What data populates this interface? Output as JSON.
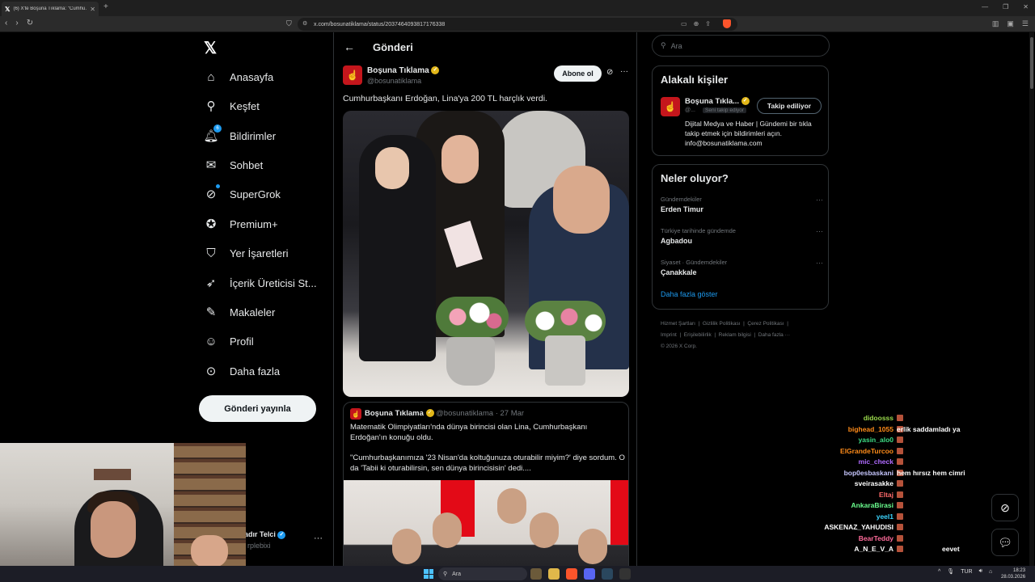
{
  "browser": {
    "tab_title": "(6) X'te Boşuna Tıklama: \"Cumhu...",
    "url": "x.com/bosunatiklama/status/2037464093817176338"
  },
  "nav": {
    "items": [
      {
        "label": "Anasayfa",
        "icon": "home-icon"
      },
      {
        "label": "Keşfet",
        "icon": "search-icon"
      },
      {
        "label": "Bildirimler",
        "icon": "bell-icon",
        "badge": "6"
      },
      {
        "label": "Sohbet",
        "icon": "mail-icon"
      },
      {
        "label": "SuperGrok",
        "icon": "grok-icon"
      },
      {
        "label": "Premium+",
        "icon": "premium-icon"
      },
      {
        "label": "Yer İşaretleri",
        "icon": "bookmark-icon"
      },
      {
        "label": "İçerik Üreticisi St...",
        "icon": "rocket-icon"
      },
      {
        "label": "Makaleler",
        "icon": "article-icon"
      },
      {
        "label": "Profil",
        "icon": "person-icon"
      },
      {
        "label": "Daha fazla",
        "icon": "more-circle-icon"
      }
    ],
    "post_button": "Gönderi yayınla",
    "account_name": "adır Telci",
    "account_handle": "rplebixi"
  },
  "post": {
    "header": "Gönderi",
    "author": "Boşuna Tıklama",
    "handle": "@bosunatiklama",
    "follow_label": "Abone ol",
    "text": "Cumhurbaşkanı Erdoğan, Lina'ya 200 TL harçlık verdi.",
    "quote": {
      "author": "Boşuna Tıklama",
      "handle": "@bosunatiklama",
      "date": "· 27 Mar",
      "text1": "Matematik Olimpiyatları'nda dünya birincisi olan Lina, Cumhurbaşkanı Erdoğan'ın konuğu oldu.",
      "text2": "\"Cumhurbaşkanımıza '23 Nisan'da koltuğunuza oturabilir miyim?' diye sordum. O da 'Tabii ki oturabilirsin, sen dünya birincisisin' dedi...."
    }
  },
  "sidebar": {
    "search_placeholder": "Ara",
    "related_title": "Alakalı kişiler",
    "related": {
      "name": "Boşuna Tıkla...",
      "handle": "@...",
      "tag": "Seni takip ediyor",
      "button": "Takip ediliyor",
      "bio": "Dijital Medya ve Haber | Gündemi bir tıkla takip etmek için bildirimleri açın. info@bosunatiklama.com"
    },
    "trends_title": "Neler oluyor?",
    "trends": [
      {
        "category": "Gündemdekiler",
        "topic": "Erden Timur"
      },
      {
        "category": "Türkiye tarihinde gündemde",
        "topic": "Agbadou"
      },
      {
        "category": "Siyaset · Gündemdekiler",
        "topic": "Çanakkale"
      }
    ],
    "show_more": "Daha fazla göster",
    "footer": [
      "Hizmet Şartları",
      "Gizlilik Politikası",
      "Çerez Politikası",
      "Imprint",
      "Erişilebilirlik",
      "Reklam bilgisi",
      "Daha fazla ···",
      "© 2026 X Corp."
    ]
  },
  "chat": [
    {
      "user": "didoosss",
      "color": "#9ad94b",
      "msg": ""
    },
    {
      "user": "bighead_1055",
      "color": "#ff8c1a",
      "msg": "erlik saddamladı ya"
    },
    {
      "user": "yasin_alo0",
      "color": "#3ddc84",
      "msg": ""
    },
    {
      "user": "ElGrandeTurcoo",
      "color": "#ff8c1a",
      "msg": ""
    },
    {
      "user": "mic_check",
      "color": "#b06bff",
      "msg": ""
    },
    {
      "user": "bop0esbaskani",
      "color": "#c7c7ff",
      "msg": "hem hırsız hem cimri"
    },
    {
      "user": "sveirasakke",
      "color": "#ffffff",
      "msg": ""
    },
    {
      "user": "Eltaj",
      "color": "#ff6b6b",
      "msg": ""
    },
    {
      "user": "AnkaraBirasi",
      "color": "#6bff8f",
      "msg": ""
    },
    {
      "user": "yeel1",
      "color": "#3dd6ff",
      "msg": ""
    },
    {
      "user": "ASKENAZ_YAHUDISI",
      "color": "#ffffff",
      "msg": ""
    },
    {
      "user": "BearTeddy",
      "color": "#ff6b9a",
      "msg": ""
    },
    {
      "user": "A_N_E_V_A",
      "color": "#ffffff",
      "msg": "eevet"
    }
  ],
  "taskbar": {
    "search": "Ara",
    "lang": "TUR",
    "time": "18:23",
    "date": "28.03.2026"
  }
}
